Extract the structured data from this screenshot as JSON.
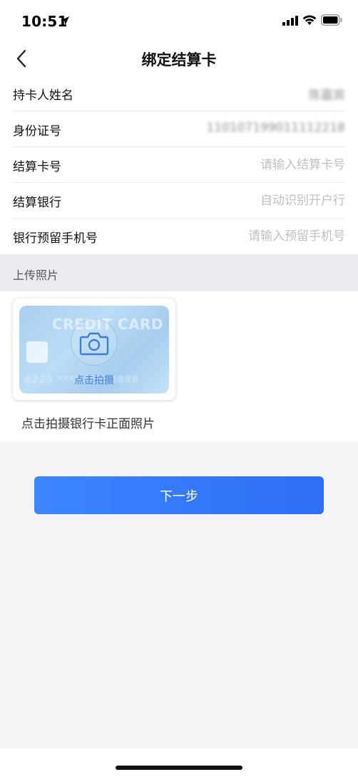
{
  "status_bar": {
    "time": "10:51",
    "icons": [
      "location-arrow-icon",
      "signal-icon",
      "wifi-icon",
      "battery-icon"
    ]
  },
  "nav": {
    "back_icon": "chevron-left-icon",
    "title": "绑定结算卡"
  },
  "form": {
    "rows": [
      {
        "label": "持卡人姓名",
        "value": "陈嘉宾",
        "blurred": true
      },
      {
        "label": "身份证号",
        "value": "110107199011112218",
        "blurred": true
      },
      {
        "label": "结算卡号",
        "placeholder": "请输入结算卡号"
      },
      {
        "label": "结算银行",
        "placeholder": "自动识别开户行"
      },
      {
        "label": "银行预留手机号",
        "placeholder": "请输入预留手机号"
      }
    ]
  },
  "upload": {
    "section_title": "上传照片",
    "card_brand": "CREDIT CARD",
    "card_number": "6225 **** **** 8888",
    "card_caption": "点击拍摄",
    "hint": "点击拍摄银行卡正面照片",
    "camera_icon": "camera-icon"
  },
  "actions": {
    "next_label": "下一步"
  },
  "colors": {
    "primary": "#3c86ff",
    "background": "#f4f4f6",
    "section_header": "#ecebf0",
    "placeholder": "#c0c0c4"
  }
}
